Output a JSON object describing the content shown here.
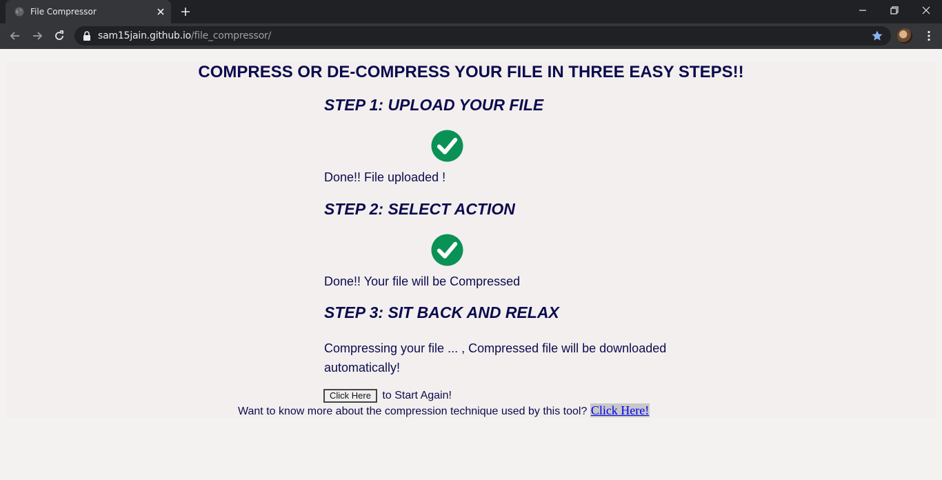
{
  "browser": {
    "tab_title": "File Compressor",
    "url_host": "sam15jain.github.io",
    "url_path": "/file_compressor/"
  },
  "page": {
    "heading": "COMPRESS OR DE-COMPRESS YOUR FILE IN THREE EASY STEPS!!",
    "step1": {
      "title": "STEP 1: UPLOAD YOUR FILE",
      "status": "Done!! File uploaded !"
    },
    "step2": {
      "title": "STEP 2: SELECT  ACTION",
      "status": "Done!! Your file will be Compressed"
    },
    "step3": {
      "title": "STEP 3: SIT BACK AND RELAX",
      "status": "Compressing your file ... , Compressed file will be downloaded automatically!"
    },
    "restart": {
      "button_label": "Click Here",
      "suffix": "to Start Again!"
    },
    "footer": {
      "text": "Want to know more about the compression technique used by this tool?",
      "link_label": "Click Here!"
    }
  },
  "colors": {
    "heading": "#0b0b4f",
    "check": "#0a9155",
    "link": "#0000ee"
  }
}
